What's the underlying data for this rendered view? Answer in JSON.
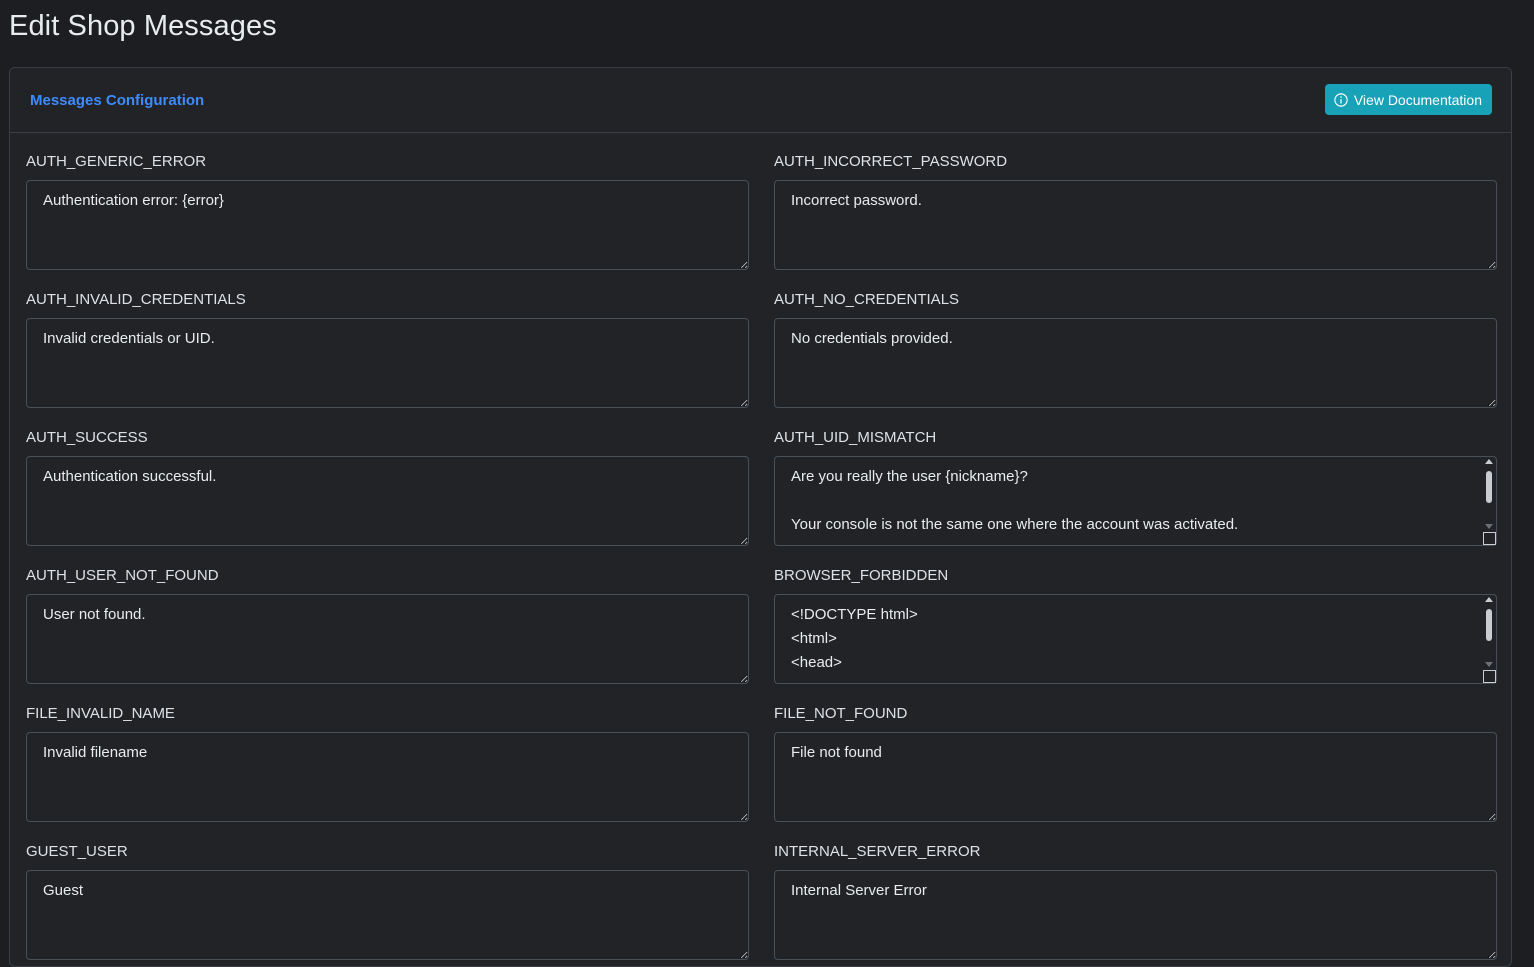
{
  "page": {
    "title": "Edit Shop Messages"
  },
  "card": {
    "title": "Messages Configuration",
    "doc_button_label": "View Documentation",
    "doc_button_icon": "info-circle-icon"
  },
  "colors": {
    "background": "#1c1e21",
    "card": "#212327",
    "accent": "#3d8bfd",
    "button": "#17a2b8"
  },
  "fields": [
    {
      "label": "AUTH_GENERIC_ERROR",
      "value": "Authentication error: {error}"
    },
    {
      "label": "AUTH_INCORRECT_PASSWORD",
      "value": "Incorrect password."
    },
    {
      "label": "AUTH_INVALID_CREDENTIALS",
      "value": "Invalid credentials or UID."
    },
    {
      "label": "AUTH_NO_CREDENTIALS",
      "value": "No credentials provided."
    },
    {
      "label": "AUTH_SUCCESS",
      "value": "Authentication successful."
    },
    {
      "label": "AUTH_UID_MISMATCH",
      "value": "Are you really the user {nickname}?\n\nYour console is not the same one where the account was activated."
    },
    {
      "label": "AUTH_USER_NOT_FOUND",
      "value": "User not found."
    },
    {
      "label": "BROWSER_FORBIDDEN",
      "value": "<!DOCTYPE html>\n<html>\n<head>"
    },
    {
      "label": "FILE_INVALID_NAME",
      "value": "Invalid filename"
    },
    {
      "label": "FILE_NOT_FOUND",
      "value": "File not found"
    },
    {
      "label": "GUEST_USER",
      "value": "Guest"
    },
    {
      "label": "INTERNAL_SERVER_ERROR",
      "value": "Internal Server Error"
    }
  ]
}
